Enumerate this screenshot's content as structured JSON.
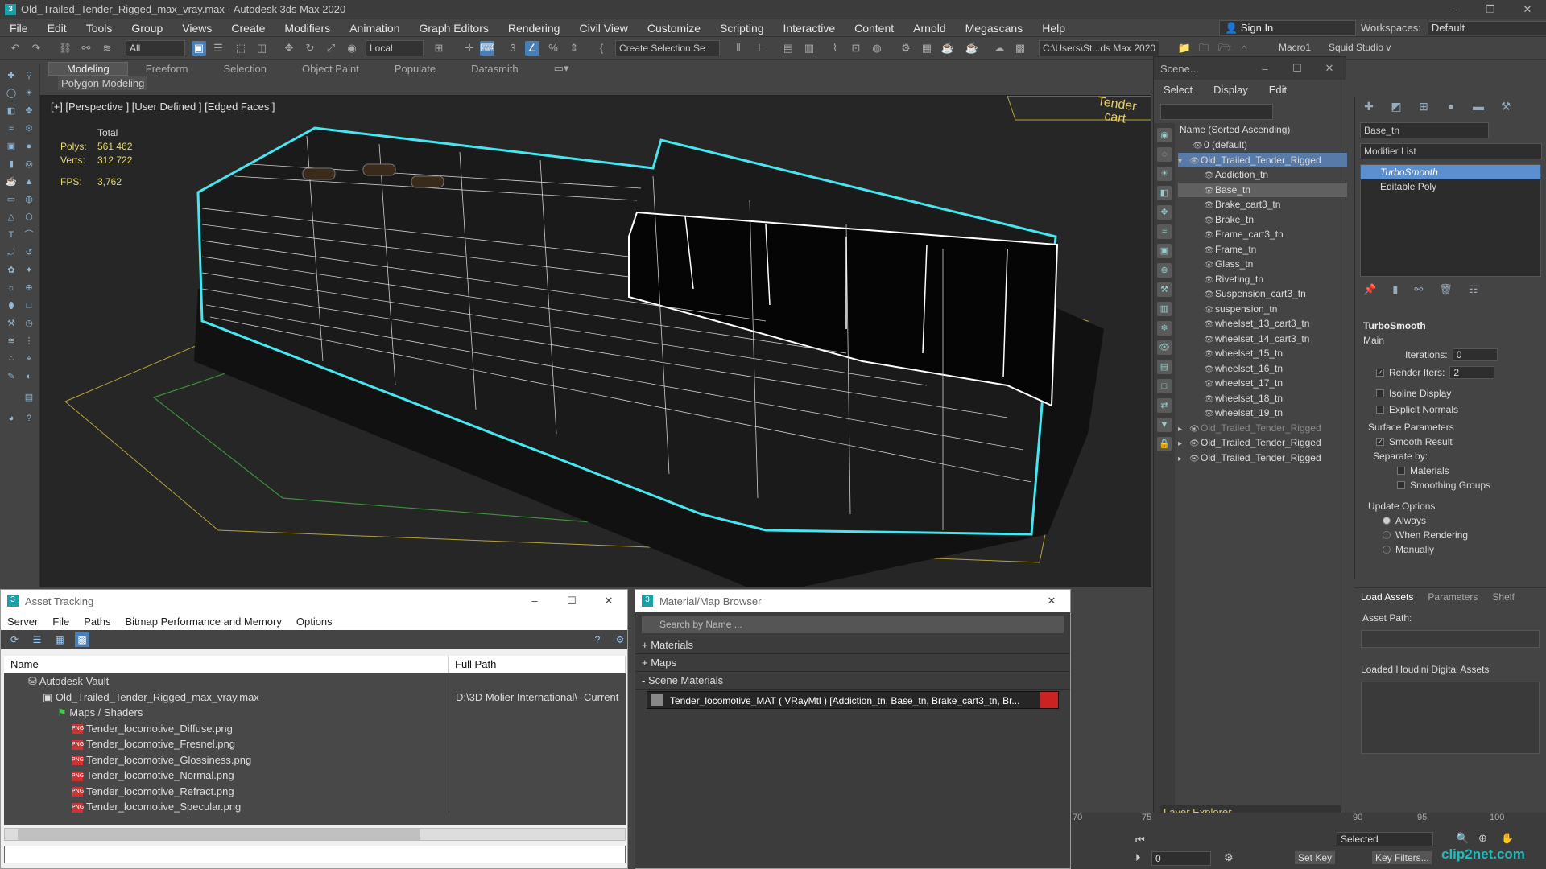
{
  "title": "Old_Trailed_Tender_Rigged_max_vray.max - Autodesk 3ds Max 2020",
  "menu": [
    "File",
    "Edit",
    "Tools",
    "Group",
    "Views",
    "Create",
    "Modifiers",
    "Animation",
    "Graph Editors",
    "Rendering",
    "Civil View",
    "Customize",
    "Scripting",
    "Interactive",
    "Content",
    "Arnold",
    "Megascans",
    "Help"
  ],
  "signin": "Sign In",
  "workspace_label": "Workspaces:",
  "workspace_value": "Default",
  "toolbar": {
    "filter": "All",
    "coord": "Local",
    "selset": "Create Selection Se",
    "path": "C:\\Users\\St...ds Max 2020",
    "macro": "Macro1",
    "squid": "Squid Studio v"
  },
  "ribbon": [
    "Modeling",
    "Freeform",
    "Selection",
    "Object Paint",
    "Populate",
    "Datasmith"
  ],
  "polymod": "Polygon Modeling",
  "viewport": {
    "label": "[+] [Perspective ] [User Defined ] [Edged Faces ]",
    "total": "Total",
    "polys_k": "Polys:",
    "polys_v": "561 462",
    "verts_k": "Verts:",
    "verts_v": "312 722",
    "fps_k": "FPS:",
    "fps_v": "3,762",
    "sign": "Tender cart"
  },
  "scene": {
    "title": "Scene...",
    "menu": [
      "Select",
      "Display",
      "Edit"
    ],
    "col": "Name (Sorted Ascending)",
    "rows": [
      "0 (default)",
      "Old_Trailed_Tender_Rigged",
      "Addiction_tn",
      "Base_tn",
      "Brake_cart3_tn",
      "Brake_tn",
      "Frame_cart3_tn",
      "Frame_tn",
      "Glass_tn",
      "Riveting_tn",
      "Suspension_cart3_tn",
      "suspension_tn",
      "wheelset_13_cart3_tn",
      "wheelset_14_cart3_tn",
      "wheelset_15_tn",
      "wheelset_16_tn",
      "wheelset_17_tn",
      "wheelset_18_tn",
      "wheelset_19_tn",
      "Old_Trailed_Tender_Rigged",
      "Old_Trailed_Tender_Rigged",
      "Old_Trailed_Tender_Rigged"
    ],
    "layer": "Layer Explorer"
  },
  "modifier": {
    "name": "Base_tn",
    "list": "Modifier List",
    "stack": [
      "TurboSmooth",
      "Editable Poly"
    ],
    "ts": "TurboSmooth",
    "main": "Main",
    "iter_k": "Iterations:",
    "iter_v": "0",
    "render_k": "Render Iters:",
    "render_v": "2",
    "isoline": "Isoline Display",
    "explicit": "Explicit Normals",
    "surf": "Surface Parameters",
    "smooth": "Smooth Result",
    "sep": "Separate by:",
    "materials": "Materials",
    "sg": "Smoothing Groups",
    "update": "Update Options",
    "always": "Always",
    "whenr": "When Rendering",
    "manually": "Manually"
  },
  "assets_panel": {
    "tabs": [
      "Load Assets",
      "Parameters",
      "Shelf"
    ],
    "path": "Asset Path:",
    "loaded": "Loaded Houdini Digital Assets"
  },
  "asset_tracking": {
    "title": "Asset Tracking",
    "menu": [
      "Server",
      "File",
      "Paths",
      "Bitmap Performance and Memory",
      "Options"
    ],
    "col_name": "Name",
    "col_path": "Full Path",
    "rows": [
      {
        "n": "Autodesk Vault",
        "p": ""
      },
      {
        "n": "Old_Trailed_Tender_Rigged_max_vray.max",
        "p": "D:\\3D Molier International\\- Current"
      },
      {
        "n": "Maps / Shaders",
        "p": ""
      },
      {
        "n": "Tender_locomotive_Diffuse.png",
        "p": ""
      },
      {
        "n": "Tender_locomotive_Fresnel.png",
        "p": ""
      },
      {
        "n": "Tender_locomotive_Glossiness.png",
        "p": ""
      },
      {
        "n": "Tender_locomotive_Normal.png",
        "p": ""
      },
      {
        "n": "Tender_locomotive_Refract.png",
        "p": ""
      },
      {
        "n": "Tender_locomotive_Specular.png",
        "p": ""
      }
    ]
  },
  "mat_browser": {
    "title": "Material/Map Browser",
    "search": "Search by Name ...",
    "materials": "+ Materials",
    "maps": "+ Maps",
    "scene": "- Scene Materials",
    "mat": "Tender_locomotive_MAT ( VRayMtl ) [Addiction_tn, Base_tn, Brake_cart3_tn, Br..."
  },
  "timeline": {
    "t70": "70",
    "t75": "75",
    "t90": "90",
    "t95": "95",
    "t100": "100",
    "setkey": "Set Key",
    "keyfilters": "Key Filters...",
    "selected": "Selected",
    "frame": "0"
  },
  "watermark": "clip2net.com"
}
